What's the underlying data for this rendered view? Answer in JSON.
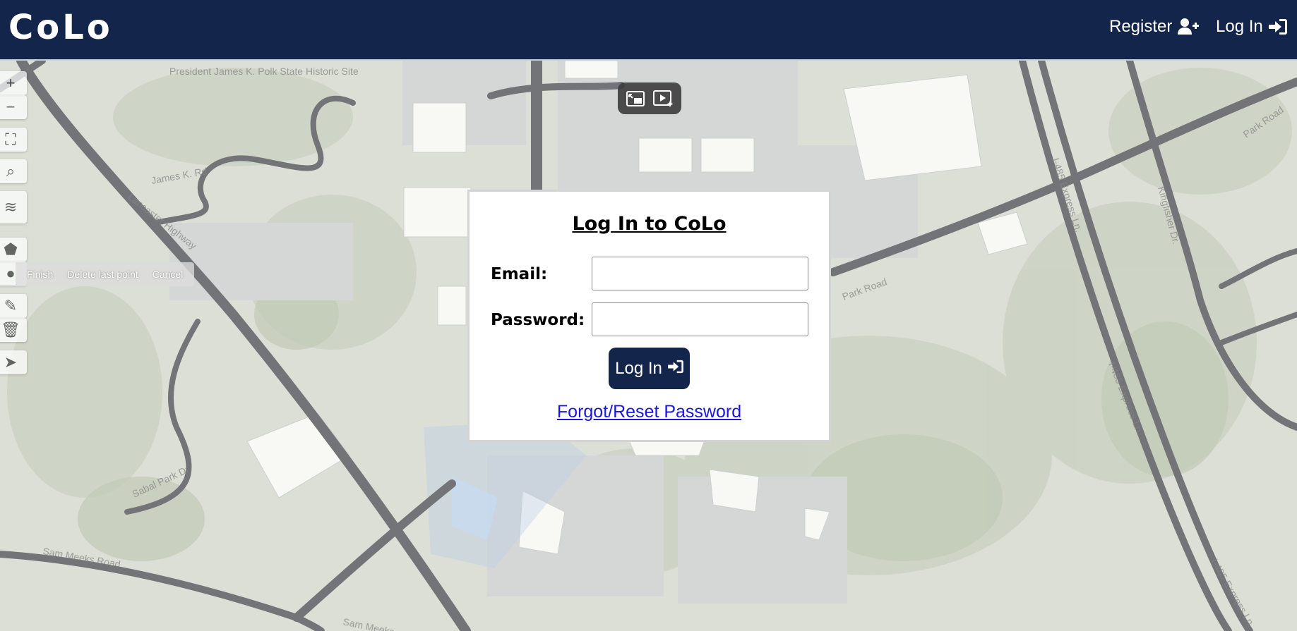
{
  "navbar": {
    "brand": "CoLo",
    "register_label": "Register",
    "register_icon": "user-plus-icon",
    "login_label": "Log In",
    "login_icon": "sign-in-icon",
    "bg_color": "#14254b"
  },
  "map": {
    "labels": {
      "historic_site": "President James K. Polk State Historic Site",
      "james_k_rd": "James K. Rd",
      "lancaster_hwy": "Lancaster Highway",
      "park_road": "Park Road",
      "park_road_ne": "Park Road",
      "kingfisher": "Kingfisher Dr.",
      "express_1": "I-485 Express Ln.",
      "express_2": "I-485 Express Ln.",
      "express_3": "I-485 Express Ln.",
      "sabal_park": "Sabal Park Dr.",
      "sam_meeks": "Sam Meeks Road",
      "sam_meeks_2": "Sam Meeks"
    },
    "draw_actions": [
      "Finish",
      "Delete last point",
      "Cancel"
    ]
  },
  "login": {
    "title": "Log In to CoLo",
    "email_label": "Email:",
    "email_value": "",
    "password_label": "Password:",
    "password_value": "",
    "submit_label": "Log In",
    "forgot_link": "Forgot/Reset Password"
  }
}
